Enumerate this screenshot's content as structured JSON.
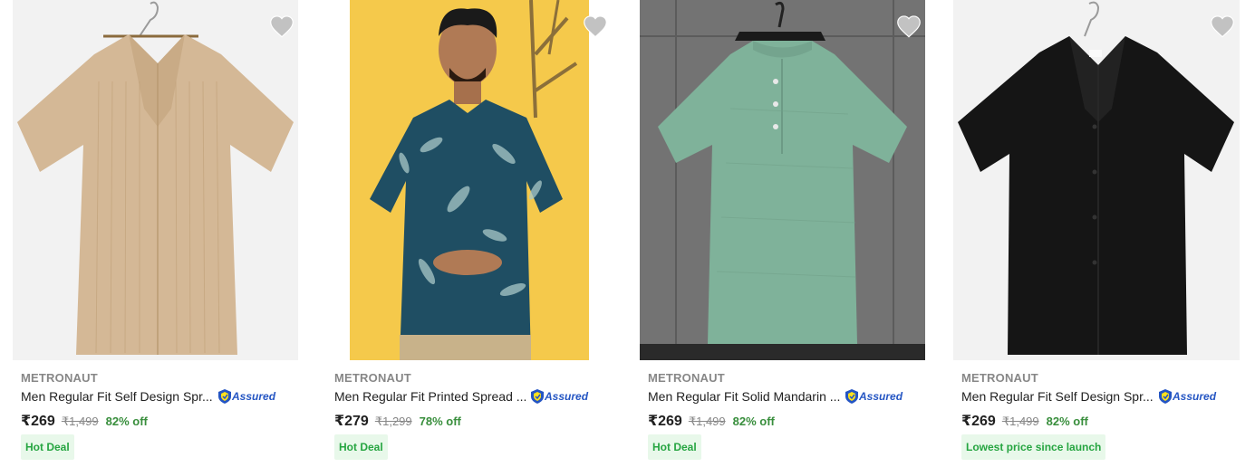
{
  "products": [
    {
      "brand": "METRONAUT",
      "title": "Men Regular Fit Self Design Spr...",
      "assured": "Assured",
      "price": "₹269",
      "mrp": "₹1,499",
      "discount": "82% off",
      "badge": "Hot Deal",
      "shirt_color": "#d4b896",
      "bg": "#f2f2f2"
    },
    {
      "brand": "METRONAUT",
      "title": "Men Regular Fit Printed Spread ...",
      "assured": "Assured",
      "price": "₹279",
      "mrp": "₹1,299",
      "discount": "78% off",
      "badge": "Hot Deal",
      "shirt_color": "#1f4e63",
      "bg": "#f5c94b"
    },
    {
      "brand": "METRONAUT",
      "title": "Men Regular Fit Solid Mandarin ...",
      "assured": "Assured",
      "price": "₹269",
      "mrp": "₹1,499",
      "discount": "82% off",
      "badge": "Hot Deal",
      "shirt_color": "#7fb29a",
      "bg": "#6c6c6c"
    },
    {
      "brand": "METRONAUT",
      "title": "Men Regular Fit Self Design Spr...",
      "assured": "Assured",
      "price": "₹269",
      "mrp": "₹1,499",
      "discount": "82% off",
      "badge": "Lowest price since launch",
      "shirt_color": "#151515",
      "bg": "#f2f2f2"
    }
  ],
  "icons": {
    "wishlist": "heart-icon",
    "assured": "shield-icon"
  },
  "colors": {
    "accent": "#2874f0",
    "discount": "#388e3c",
    "badge_bg": "#e8f8ea",
    "badge_text": "#26a541",
    "assured": "#2455c3"
  }
}
